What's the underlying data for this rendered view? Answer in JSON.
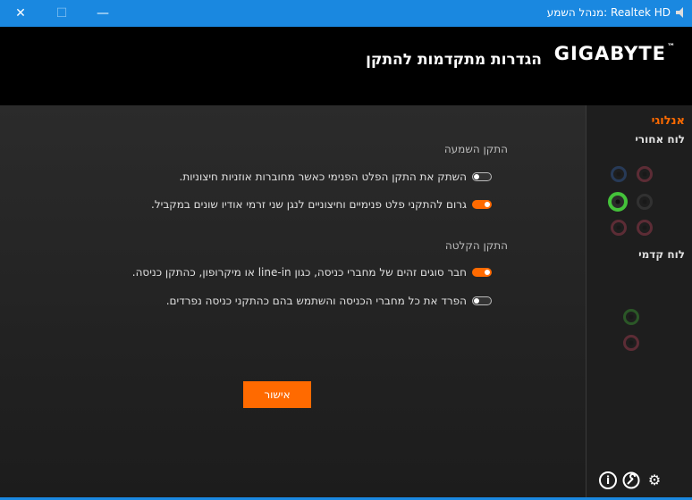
{
  "window": {
    "title": "Realtek HD :מנהל השמע",
    "close_glyph": "✕",
    "max_glyph": "☐",
    "min_glyph": "—"
  },
  "header": {
    "brand": "GIGABYTE",
    "brand_tm": "™",
    "title": "הגדרות מתקדמות להתקן"
  },
  "playback": {
    "section_label": "התקן השמעה",
    "options": [
      {
        "label": "השתק את התקן הפלט הפנימי כאשר מחוברות אוזניות חיצוניות.",
        "on": false
      },
      {
        "label": "גרום להתקני פלט פנימיים וחיצוניים לנגן שני זרמי אודיו שונים במקביל.",
        "on": true
      }
    ]
  },
  "recording": {
    "section_label": "התקן הקלטה",
    "options": [
      {
        "label": "חבר סוגים זהים של מחברי כניסה, כגון line-in או מיקרופון, כהתקן כניסה.",
        "on": true
      },
      {
        "label": "הפרד את כל מחברי הכניסה והשתמש בהם כהתקני כניסה נפרדים.",
        "on": false
      }
    ]
  },
  "ok_button": "אישור",
  "side": {
    "title": "אנלוגי",
    "back_panel": "לוח אחורי",
    "front_panel": "לוח קדמי"
  },
  "footer": {
    "info_glyph": "i",
    "wrench_glyph": "🔧",
    "gear_glyph": "⚙"
  },
  "colors": {
    "accent": "#ff6a00",
    "titlebar": "#1a88e0",
    "jack_green": "#44c23a",
    "jack_pink": "#d04860",
    "jack_blue": "#3a6fc2"
  }
}
